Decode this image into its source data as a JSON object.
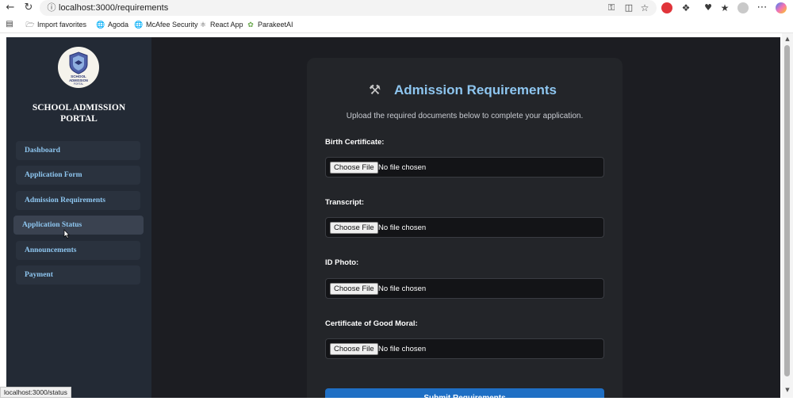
{
  "browser": {
    "url": "localhost:3000/requirements",
    "status_url": "localhost:3000/status",
    "toolbar_icons": [
      "back-arrow-icon",
      "refresh-icon",
      "info-icon",
      "key-icon",
      "split-screen-icon",
      "star-icon",
      "adblock-icon",
      "extensions-icon",
      "browser-essentials-icon",
      "favorites-icon",
      "profile-avatar-icon",
      "more-icon",
      "copilot-icon"
    ],
    "favorites": [
      {
        "label": "Import favorites",
        "icon": "folder-import-icon"
      },
      {
        "label": "Agoda",
        "icon": "globe-icon"
      },
      {
        "label": "McAfee Security",
        "icon": "globe-icon"
      },
      {
        "label": "React App",
        "icon": "react-icon"
      },
      {
        "label": "ParakeetAI",
        "icon": "parakeet-icon"
      }
    ]
  },
  "sidebar": {
    "logo_text": "SCHOOL ADMISSION PORTAL",
    "title": "SCHOOL ADMISSION PORTAL",
    "items": [
      {
        "label": "Dashboard"
      },
      {
        "label": "Application Form"
      },
      {
        "label": "Admission Requirements"
      },
      {
        "label": "Application Status"
      },
      {
        "label": "Announcements"
      },
      {
        "label": "Payment"
      }
    ],
    "hovered_item": "Application Status"
  },
  "main": {
    "title": "Admission Requirements",
    "title_icon": "tools-icon",
    "subtitle": "Upload the required documents below to complete your application.",
    "fields": [
      {
        "label": "Birth Certificate:",
        "button": "Choose File",
        "status": "No file chosen"
      },
      {
        "label": "Transcript:",
        "button": "Choose File",
        "status": "No file chosen"
      },
      {
        "label": "ID Photo:",
        "button": "Choose File",
        "status": "No file chosen"
      },
      {
        "label": "Certificate of Good Moral:",
        "button": "Choose File",
        "status": "No file chosen"
      }
    ],
    "submit_label": "Submit Requirements"
  },
  "colors": {
    "accent_blue": "#8ec6f0",
    "submit_blue": "#1f6fc4",
    "sidebar_bg": "#232a35",
    "card_bg": "#232529"
  }
}
